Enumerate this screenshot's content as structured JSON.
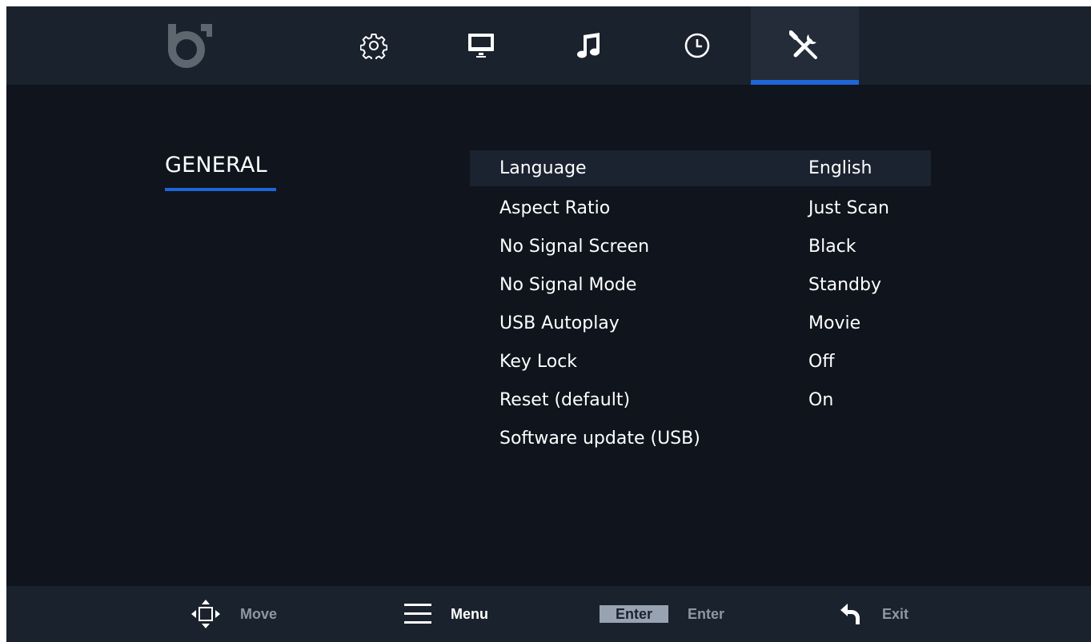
{
  "nav": {
    "tabs": [
      {
        "id": "settings",
        "icon": "gear-icon",
        "active": false
      },
      {
        "id": "display",
        "icon": "monitor-icon",
        "active": false
      },
      {
        "id": "music",
        "icon": "music-note-icon",
        "active": false
      },
      {
        "id": "clock",
        "icon": "clock-icon",
        "active": false
      },
      {
        "id": "tools",
        "icon": "tools-icon",
        "active": true
      }
    ],
    "logo_icon": "brand-logo"
  },
  "section": {
    "title": "GENERAL"
  },
  "menu": {
    "items": [
      {
        "label": "Language",
        "value": "English",
        "selected": true
      },
      {
        "label": "Aspect Ratio",
        "value": "Just Scan"
      },
      {
        "label": "No Signal Screen",
        "value": "Black"
      },
      {
        "label": "No Signal Mode",
        "value": "Standby"
      },
      {
        "label": "USB Autoplay",
        "value": "Movie"
      },
      {
        "label": "Key Lock",
        "value": "Off"
      },
      {
        "label": "Reset (default)",
        "value": "On"
      },
      {
        "label": "Software update (USB)",
        "value": ""
      }
    ]
  },
  "hints": {
    "move": "Move",
    "menu": "Menu",
    "enter_key": "Enter",
    "enter": "Enter",
    "exit": "Exit"
  },
  "colors": {
    "accent": "#1e66d8",
    "background": "#0f141d",
    "bar": "#1a222d",
    "selected_row": "#1b2330",
    "muted_text": "#8e97a3"
  }
}
